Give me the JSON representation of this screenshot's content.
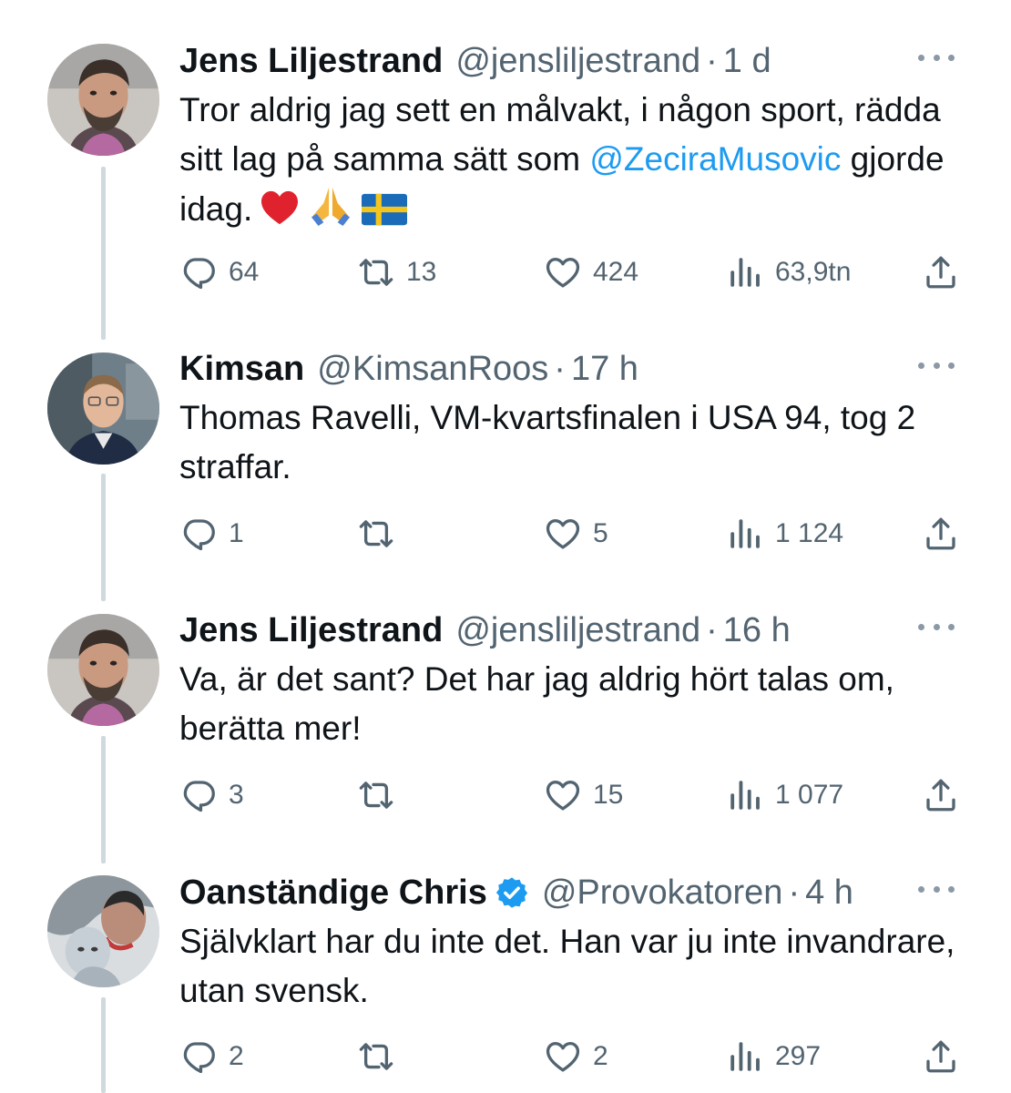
{
  "tweets": [
    {
      "name": "Jens Liljestrand",
      "handle": "@jensliljestrand",
      "time": "1 d",
      "verified": false,
      "text_before": "Tror aldrig jag sett en målvakt, i någon sport, rädda sitt lag på samma sätt som",
      "mention": "@ZeciraMusovic",
      "text_after": "gjorde idag.",
      "emojis": [
        "heart-emoji",
        "praying-hands-emoji",
        "swedish-flag-emoji"
      ],
      "replies": "64",
      "retweets": "13",
      "likes": "424",
      "views": "63,9tn"
    },
    {
      "name": "Kimsan",
      "handle": "@KimsanRoos",
      "time": "17 h",
      "verified": false,
      "text": "Thomas Ravelli, VM-kvartsfinalen i USA 94, tog 2 straffar.",
      "replies": "1",
      "retweets": "",
      "likes": "5",
      "views": "1 124"
    },
    {
      "name": "Jens Liljestrand",
      "handle": "@jensliljestrand",
      "time": "16 h",
      "verified": false,
      "text": "Va, är det sant? Det har jag aldrig hört talas om, berätta mer!",
      "replies": "3",
      "retweets": "",
      "likes": "15",
      "views": "1 077"
    },
    {
      "name": "Oanständige Chris",
      "handle": "@Provokatoren",
      "time": "4 h",
      "verified": true,
      "text": "Självklart har du inte det. Han var ju inte invandrare, utan svensk.",
      "replies": "2",
      "retweets": "",
      "likes": "2",
      "views": "297"
    }
  ],
  "separator": "·",
  "colors": {
    "text": "#0f1419",
    "secondary": "#536471",
    "link": "#1d9bf0",
    "thread_line": "#cfd9de",
    "verified": "#1d9bf0"
  },
  "icons": [
    "reply-icon",
    "retweet-icon",
    "like-icon",
    "views-icon",
    "share-icon",
    "more-icon",
    "verified-badge-icon"
  ]
}
